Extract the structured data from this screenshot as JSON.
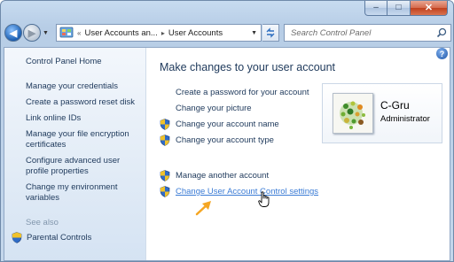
{
  "window": {
    "caption_buttons": {
      "minimize": "–",
      "maximize": "□",
      "close": "✕"
    }
  },
  "navbar": {
    "back_icon": "back-arrow-icon",
    "forward_icon": "forward-arrow-icon",
    "address": {
      "prefix": "«",
      "crumbs": [
        "User Accounts an...",
        "User Accounts"
      ],
      "separator": "▸"
    },
    "search_placeholder": "Search Control Panel"
  },
  "sidebar": {
    "home": "Control Panel Home",
    "items": [
      "Manage your credentials",
      "Create a password reset disk",
      "Link online IDs",
      "Manage your file encryption certificates",
      "Configure advanced user profile properties",
      "Change my environment variables"
    ],
    "see_also_label": "See also",
    "see_also_items": [
      "Parental Controls"
    ]
  },
  "main": {
    "title": "Make changes to your user account",
    "tasks": [
      {
        "label": "Create a password for your account",
        "shield": false
      },
      {
        "label": "Change your picture",
        "shield": false
      },
      {
        "label": "Change your account name",
        "shield": true
      },
      {
        "label": "Change your account type",
        "shield": true
      }
    ],
    "tasks2": [
      {
        "label": "Manage another account",
        "shield": true
      },
      {
        "label": "Change User Account Control settings",
        "shield": true,
        "hovered": true
      }
    ],
    "help_label": "?"
  },
  "user": {
    "name": "C-Gru",
    "role": "Administrator"
  },
  "colors": {
    "accent_arrow": "#f5a623",
    "link_hover": "#3a7bd5",
    "text": "#1e395b"
  }
}
